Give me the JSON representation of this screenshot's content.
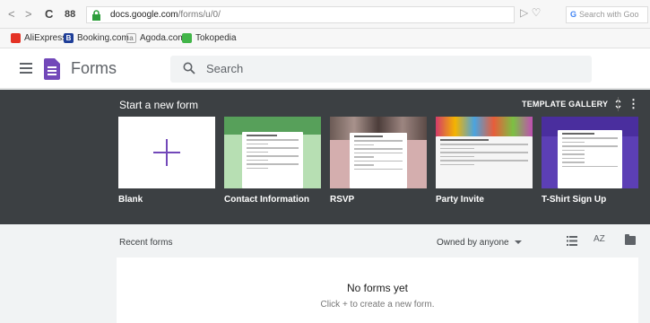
{
  "browser": {
    "back": "<",
    "forward": ">",
    "reload": "C",
    "apps": "88",
    "url_domain": "docs.google.com",
    "url_path": "/forms/u/0/",
    "right_icons": "▷ ♡",
    "google_search_placeholder": "Search with Goo",
    "google_g": "G"
  },
  "bookmarks": [
    {
      "label": "AliExpress",
      "icon": "aliexpress-icon",
      "color": "#e43225",
      "glyph": ""
    },
    {
      "label": "Booking.com",
      "icon": "booking-icon",
      "color": "#1f3f99",
      "glyph": "B"
    },
    {
      "label": "Agoda.com",
      "icon": "agoda-icon",
      "color": "#888888",
      "glyph": "a"
    },
    {
      "label": "Tokopedia",
      "icon": "tokopedia-icon",
      "color": "#42b549",
      "glyph": ""
    }
  ],
  "header": {
    "app_title": "Forms",
    "search_placeholder": "Search"
  },
  "templates": {
    "section_title": "Start a new form",
    "gallery_label": "TEMPLATE GALLERY",
    "more": "⋮",
    "gallery_chevron": "⌃⌄",
    "items": [
      {
        "label": "Blank"
      },
      {
        "label": "Contact Information",
        "accent": "#b7dfb3"
      },
      {
        "label": "RSVP",
        "accent": "#d4aeae"
      },
      {
        "label": "Party Invite",
        "accent": "#ffffff"
      },
      {
        "label": "T-Shirt Sign Up",
        "accent": "#5c3fb5"
      }
    ]
  },
  "recent": {
    "title": "Recent forms",
    "owned_filter": "Owned by anyone",
    "sort_label": "AZ",
    "empty_title": "No forms yet",
    "empty_subtitle": "Click + to create a new form."
  },
  "colors": {
    "brand": "#7248b9",
    "template_band": "#3c4043"
  }
}
